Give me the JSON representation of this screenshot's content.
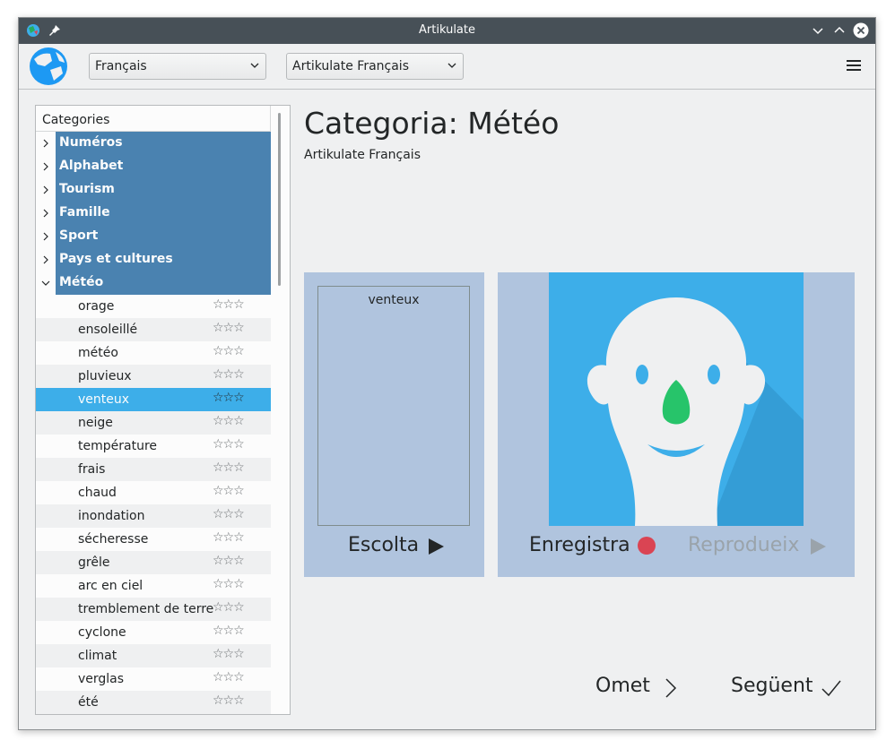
{
  "window": {
    "title": "Artikulate"
  },
  "toolbar": {
    "language": "Français",
    "course": "Artikulate Français"
  },
  "tree": {
    "header": "Categories",
    "categories": [
      {
        "label": "Numéros"
      },
      {
        "label": "Alphabet"
      },
      {
        "label": "Tourism"
      },
      {
        "label": "Famille"
      },
      {
        "label": "Sport"
      },
      {
        "label": "Pays et cultures"
      },
      {
        "label": "Météo"
      }
    ],
    "words": [
      {
        "label": "orage",
        "stars": "☆☆☆"
      },
      {
        "label": "ensoleillé",
        "stars": "☆☆☆"
      },
      {
        "label": "météo",
        "stars": "☆☆☆"
      },
      {
        "label": "pluvieux",
        "stars": "☆☆☆"
      },
      {
        "label": "venteux",
        "stars": "☆☆☆"
      },
      {
        "label": "neige",
        "stars": "☆☆☆"
      },
      {
        "label": "température",
        "stars": "☆☆☆"
      },
      {
        "label": "frais",
        "stars": "☆☆☆"
      },
      {
        "label": "chaud",
        "stars": "☆☆☆"
      },
      {
        "label": "inondation",
        "stars": "☆☆☆"
      },
      {
        "label": "sécheresse",
        "stars": "☆☆☆"
      },
      {
        "label": "grêle",
        "stars": "☆☆☆"
      },
      {
        "label": "arc en ciel",
        "stars": "☆☆☆"
      },
      {
        "label": "tremblement de terre",
        "stars": "☆☆☆"
      },
      {
        "label": "cyclone",
        "stars": "☆☆☆"
      },
      {
        "label": "climat",
        "stars": "☆☆☆"
      },
      {
        "label": "verglas",
        "stars": "☆☆☆"
      },
      {
        "label": "été",
        "stars": "☆☆☆"
      }
    ]
  },
  "main": {
    "heading": "Categoria: Météo",
    "subheading": "Artikulate Français",
    "current_word": "venteux",
    "listen_label": "Escolta",
    "record_label": "Enregistra",
    "play_label": "Reprodueix",
    "skip_label": "Omet",
    "next_label": "Següent"
  },
  "colors": {
    "selection": "#3daee9",
    "category_bg": "#4a82b0",
    "panel_bg": "#b0c4de",
    "record_dot": "#da4453"
  }
}
